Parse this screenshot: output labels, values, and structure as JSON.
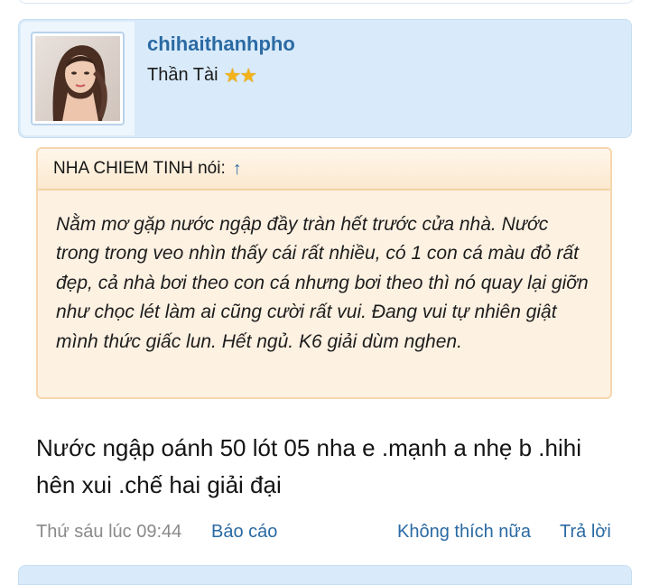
{
  "post": {
    "username": "chihaithanhpho",
    "user_title": "Thần Tài",
    "star_count": 2,
    "quote": {
      "author_label": "NHA CHIEM TINH nói:",
      "jump_icon": "↑",
      "text": "Nằm mơ gặp nước ngập đầy tràn hết trước cửa nhà. Nước trong trong veo nhìn thấy cái rất nhiều, có 1 con cá màu đỏ rất đẹp, cả nhà bơi theo con cá nhưng bơi theo thì nó quay lại giỡn như chọc lét làm ai cũng cười rất vui. Đang vui tự nhiên giật mình thức giấc lun. Hết ngủ. K6 giải dùm nghen."
    },
    "message": "Nước ngập oánh 50 lót 05 nha e .mạnh a nhẹ b .hihi hên xui .chế hai giải đại",
    "footer": {
      "timestamp": "Thứ sáu lúc 09:44",
      "report_label": "Báo cáo",
      "unlike_label": "Không thích nữa",
      "reply_label": "Trả lời"
    }
  },
  "colors": {
    "accent": "#2b6aa3",
    "user_card_bg": "#d9ebfa",
    "quote_bg": "#fdf1e2",
    "quote_border": "#f6d7ad",
    "star": "#f2b21c"
  },
  "icons": [
    "avatar-image",
    "star-icon",
    "arrow-up-icon"
  ]
}
